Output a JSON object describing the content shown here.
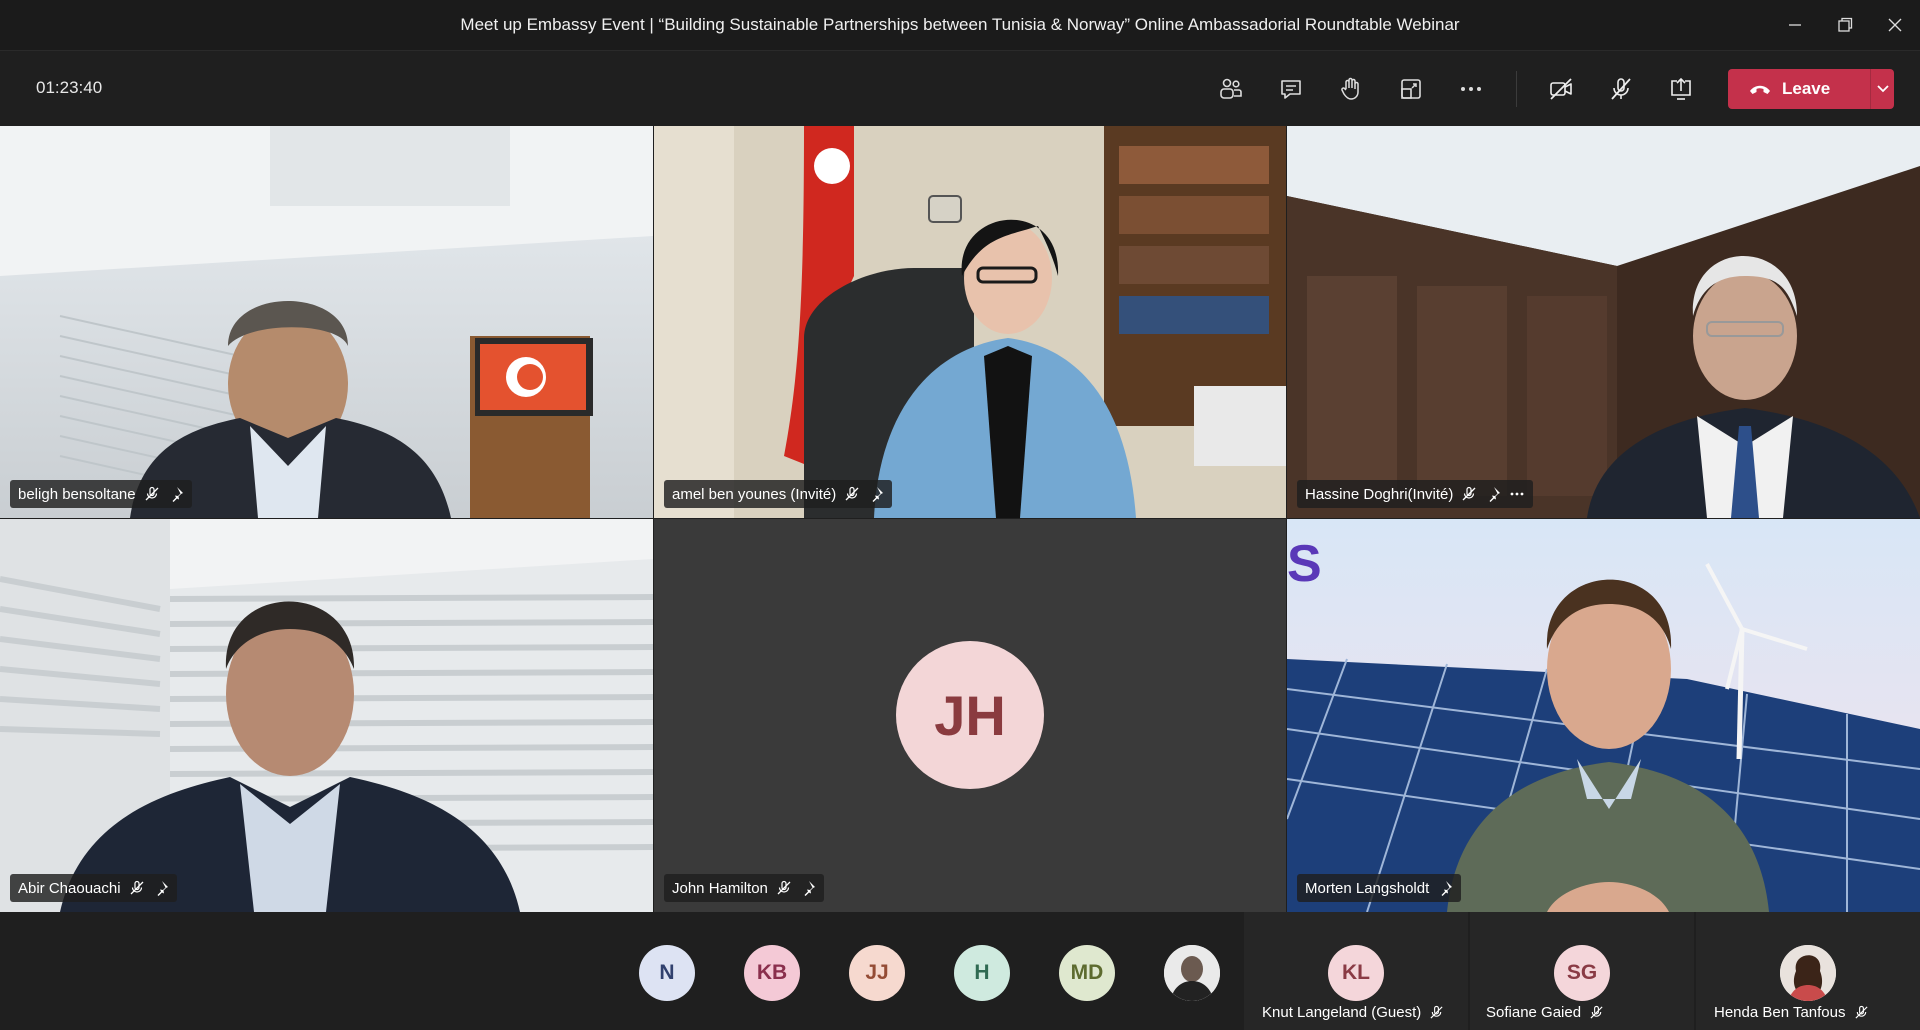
{
  "window": {
    "title": "Meet up Embassy Event | “Building Sustainable Partnerships between Tunisia & Norway” Online Ambassadorial Roundtable Webinar"
  },
  "toolbar": {
    "timer": "01:23:40",
    "leave_label": "Leave",
    "icons": [
      "participants-icon",
      "chat-icon",
      "raise-hand-icon",
      "share-tray-icon",
      "more-icon",
      "camera-off-icon",
      "mic-off-icon",
      "share-screen-icon"
    ]
  },
  "tiles": [
    {
      "name": "beligh bensoltane",
      "icons": [
        "mic-off-icon",
        "pin-icon"
      ]
    },
    {
      "name": "amel ben younes (Invité)",
      "icons": [
        "mic-off-icon",
        "pin-icon"
      ]
    },
    {
      "name": "Hassine Doghri(Invité)",
      "icons": [
        "mic-off-icon",
        "pin-icon",
        "more-icon"
      ]
    },
    {
      "name": "Abir Chaouachi",
      "icons": [
        "mic-off-icon",
        "pin-icon"
      ]
    },
    {
      "name": "John Hamilton",
      "initials": "JH",
      "icons": [
        "mic-off-icon",
        "pin-icon"
      ]
    },
    {
      "name": "Morten Langsholdt",
      "icons": [
        "pin-icon"
      ]
    }
  ],
  "overflow_participants": [
    {
      "initials": "N",
      "bg": "#dde3f3",
      "fg": "#31416e"
    },
    {
      "initials": "KB",
      "bg": "#f4c9d6",
      "fg": "#8a2f4d"
    },
    {
      "initials": "JJ",
      "bg": "#f6d9cf",
      "fg": "#944c35"
    },
    {
      "initials": "H",
      "bg": "#cfeadf",
      "fg": "#2f6a52"
    },
    {
      "initials": "MD",
      "bg": "#dfe8cf",
      "fg": "#5d6b2f"
    },
    {
      "initials": "",
      "photo": true
    }
  ],
  "featured_participants": [
    {
      "initials": "KL",
      "name": "Knut Langeland (Guest)",
      "bg": "#f4d6da",
      "fg": "#8a3b45"
    },
    {
      "initials": "SG",
      "name": "Sofiane Gaied",
      "bg": "#f4d6da",
      "fg": "#8a3b45"
    },
    {
      "initials": "",
      "name": "Henda Ben Tanfous",
      "photo": true
    }
  ],
  "colors": {
    "accent_leave": "#c4314b",
    "background": "#1f1f1f"
  }
}
